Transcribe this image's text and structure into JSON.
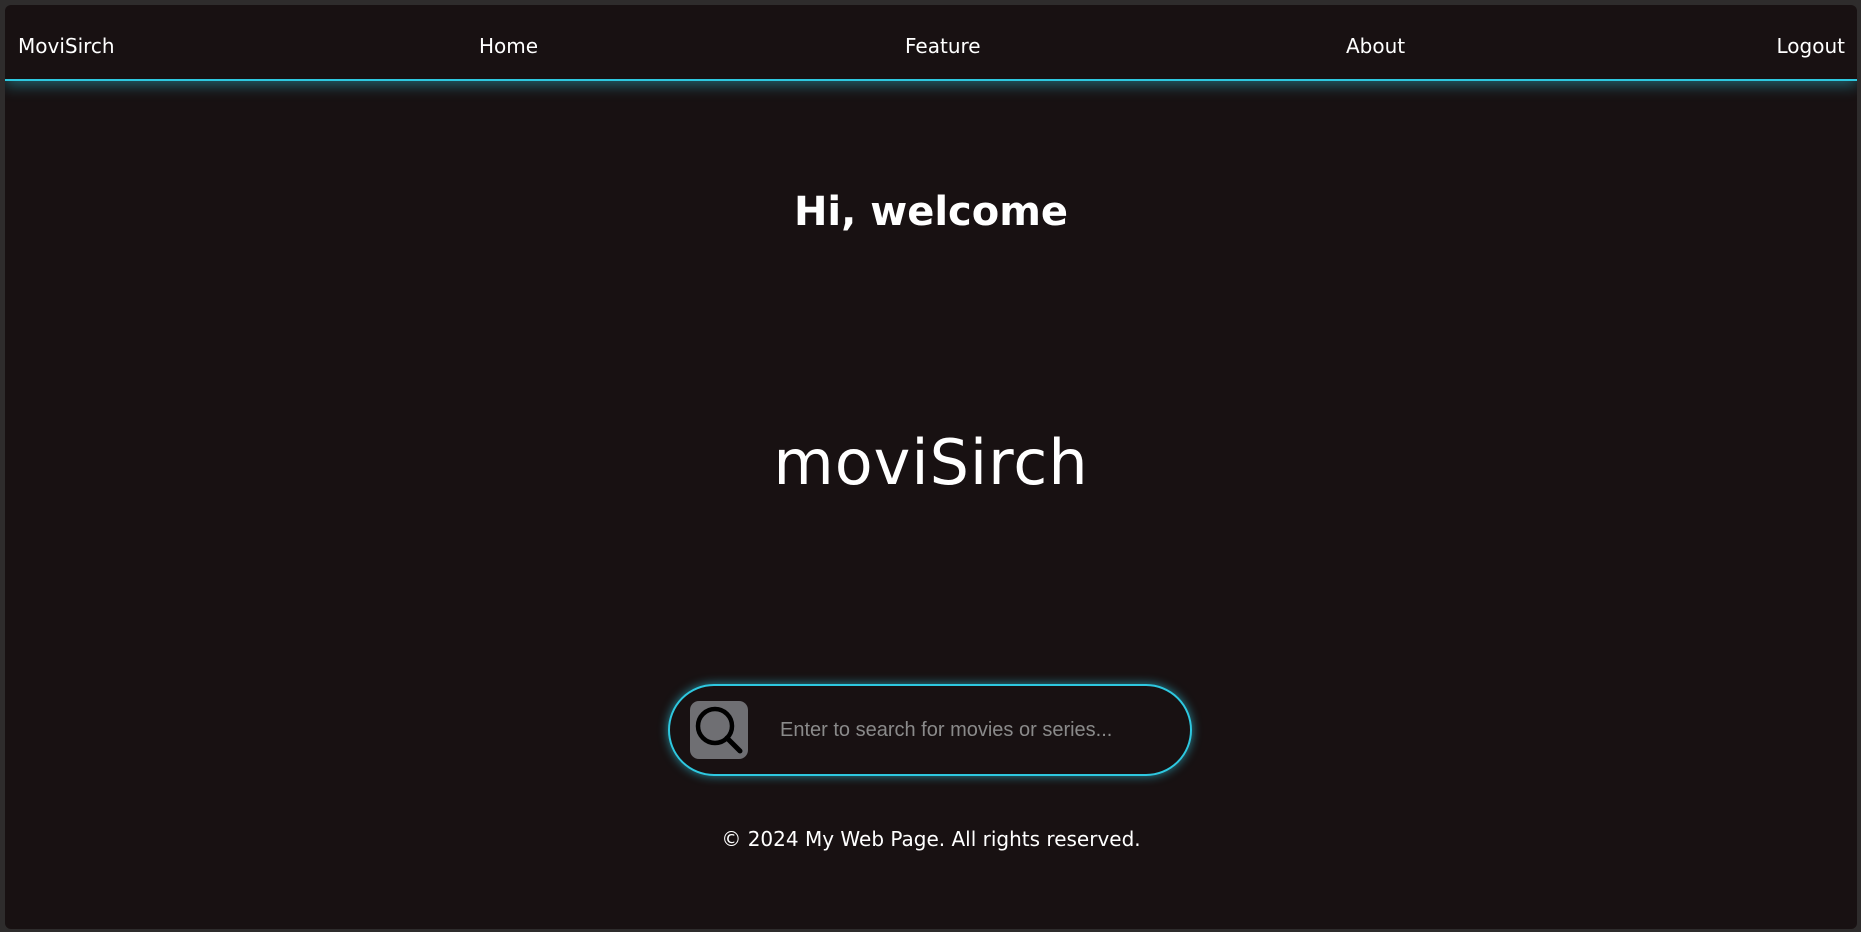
{
  "nav": {
    "brand": "MoviSirch",
    "home": "Home",
    "feature": "Feature",
    "about": "About",
    "logout": "Logout"
  },
  "hero": {
    "welcome": "Hi, welcome",
    "logo_title": "moviSirch"
  },
  "search": {
    "placeholder": "Enter to search for movies or series...",
    "value": "",
    "icon": "search-icon"
  },
  "footer": {
    "text": "© 2024 My Web Page. All rights reserved."
  },
  "colors": {
    "background": "#181112",
    "accent": "#2ec8e0",
    "text": "#ffffff",
    "search_button": "#6f6f73"
  }
}
